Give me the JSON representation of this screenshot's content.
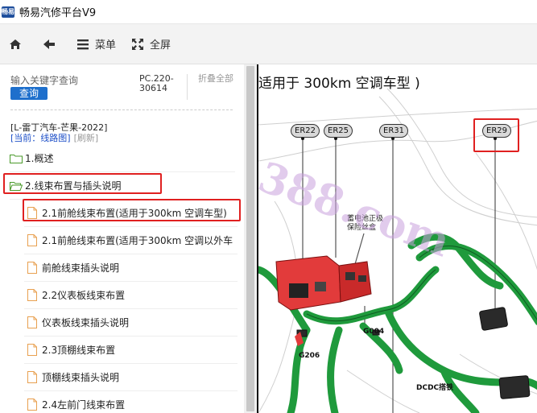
{
  "app": {
    "title": "畅易汽修平台V9",
    "logo_text": "畅易"
  },
  "toolbar": {
    "home_icon": "home-icon",
    "back_icon": "back-arrow-icon",
    "menu_label": "菜单",
    "fullscreen_label": "全屏"
  },
  "search": {
    "placeholder": "输入关键字查询",
    "button_label": "查询",
    "pc_code": "PC.220-30614",
    "collapse_all": "折叠全部"
  },
  "tree": {
    "root_label": "[L-雷丁汽车-芒果-2022]",
    "current_label": "[当前：线路图]",
    "refresh_label": "[刷新]",
    "items": [
      {
        "level": 0,
        "icon": "folder-icon",
        "label": "1.概述"
      },
      {
        "level": 0,
        "icon": "folder-open-icon",
        "label": "2.线束布置与插头说明"
      },
      {
        "level": 1,
        "icon": "file-icon",
        "label": "2.1前舱线束布置(适用于300km 空调车型)"
      },
      {
        "level": 1,
        "icon": "file-icon",
        "label": "2.1前舱线束布置(适用于300km 空调以外车"
      },
      {
        "level": 1,
        "icon": "file-icon",
        "label": "前舱线束插头说明"
      },
      {
        "level": 1,
        "icon": "file-icon",
        "label": "2.2仪表板线束布置"
      },
      {
        "level": 1,
        "icon": "file-icon",
        "label": "仪表板线束插头说明"
      },
      {
        "level": 1,
        "icon": "file-icon",
        "label": "2.3顶棚线束布置"
      },
      {
        "level": 1,
        "icon": "file-icon",
        "label": "顶棚线束插头说明"
      },
      {
        "level": 1,
        "icon": "file-icon",
        "label": "2.4左前门线束布置"
      }
    ]
  },
  "diagram": {
    "title": "适用于 300km 空调车型 )",
    "connectors": [
      "ER22",
      "ER25",
      "ER31",
      "ER29"
    ],
    "note_battery": "蓄电池正极\n保险丝盒",
    "grounds": [
      "G004",
      "G206"
    ],
    "dcdc_label": "DCDC搭铁",
    "watermark": "388.com",
    "colors": {
      "harness_green": "#1f9a3c",
      "fuse_box_red": "#e23b3b",
      "highlight_red": "#e02020"
    }
  }
}
